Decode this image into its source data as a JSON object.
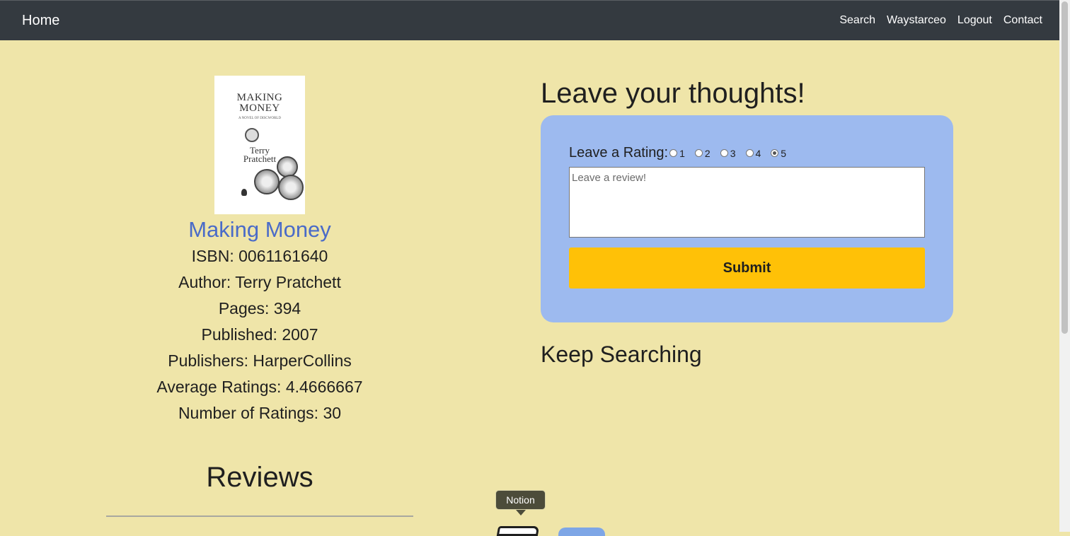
{
  "navbar": {
    "brand": "Home",
    "links": [
      "Search",
      "Waystarceo",
      "Logout",
      "Contact"
    ]
  },
  "book": {
    "cover": {
      "title_line1": "MAKING",
      "title_line2": "MONEY",
      "subtitle": "A NOVEL OF DISCWORLD",
      "author_line1": "Terry",
      "author_line2": "Pratchett"
    },
    "title": "Making Money",
    "isbn": "ISBN: 0061161640",
    "author": "Author: Terry Pratchett",
    "pages": "Pages: 394",
    "published": "Published: 2007",
    "publishers": "Publishers: HarperCollins",
    "average_ratings": "Average Ratings: 4.4666667",
    "number_of_ratings": "Number of Ratings: 30"
  },
  "reviews": {
    "heading": "Reviews"
  },
  "review_form": {
    "heading": "Leave your thoughts!",
    "rating_label": "Leave a Rating:",
    "ratings": [
      "1",
      "2",
      "3",
      "4",
      "5"
    ],
    "selected_rating": "5",
    "textarea_placeholder": "Leave a review!",
    "textarea_value": "",
    "submit_label": "Submit"
  },
  "keep_searching": {
    "heading": "Keep Searching"
  },
  "dock": {
    "tooltip": "Notion",
    "icons": [
      "notion-icon"
    ]
  },
  "colors": {
    "page_bg": "#efe5a9",
    "navbar_bg": "#343a40",
    "card_bg": "#9dbaef",
    "submit_bg": "#ffc107",
    "title_link": "#4a6bc8"
  }
}
